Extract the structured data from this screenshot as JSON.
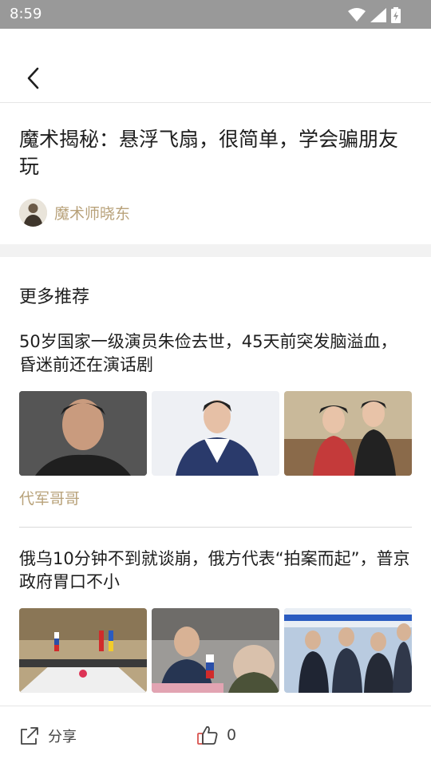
{
  "status_bar": {
    "time": "8:59",
    "icons": [
      "wifi-icon",
      "cellular-signal-icon",
      "battery-charging-icon"
    ]
  },
  "nav": {
    "back_icon": "chevron-left-icon"
  },
  "article": {
    "title": "魔术揭秘：悬浮飞扇，很简单，学会骗朋友玩",
    "author": "魔术师晓东"
  },
  "recommend": {
    "heading": "更多推荐",
    "items": [
      {
        "title": "50岁国家一级演员朱俭去世，45天前突发脑溢血，昏迷前还在演话剧",
        "source": "代军哥哥",
        "images": [
          "portrait-photo",
          "portrait-photo",
          "stage-costume-photo"
        ]
      },
      {
        "title": "俄乌10分钟不到就谈崩，俄方代表“拍案而起”，普京政府胃口不小",
        "images": [
          "negotiation-table-photo",
          "delegates-photo",
          "handshake-photo"
        ]
      }
    ]
  },
  "bottom_bar": {
    "share_label": "分享",
    "share_icon": "share-icon",
    "like_icon": "thumbs-up-icon",
    "like_count": "0"
  },
  "colors": {
    "status_bar": "#999999",
    "accent_text": "#b8a27a",
    "like_icon": "#d9534f",
    "section_gap": "#f2f2f2"
  }
}
